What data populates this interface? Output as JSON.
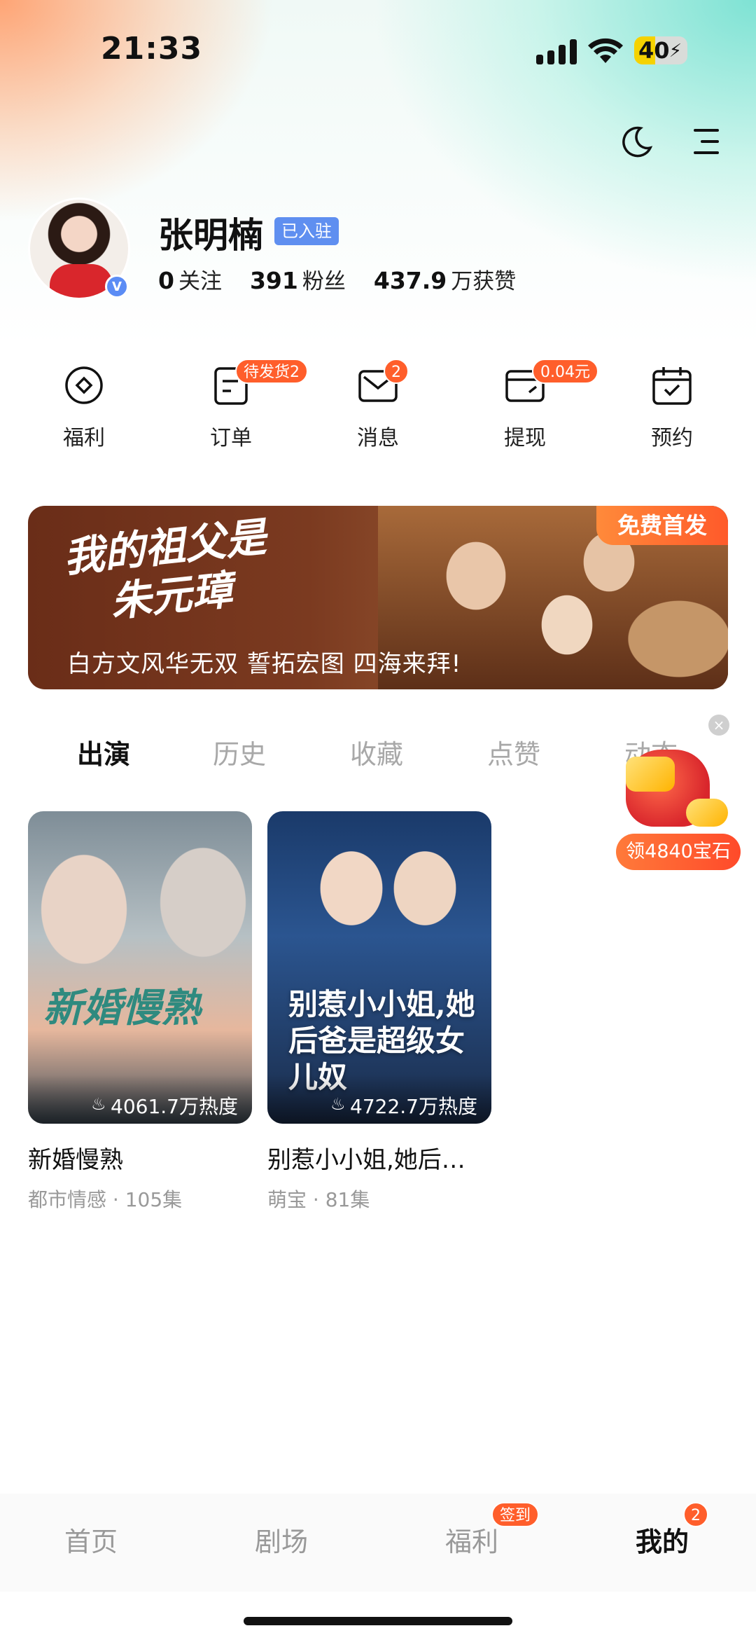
{
  "status": {
    "time": "21:33",
    "battery": "40"
  },
  "profile": {
    "name": "张明楠",
    "tag": "已入驻",
    "verify": "V",
    "stats": [
      {
        "num": "0",
        "label": "关注"
      },
      {
        "num": "391",
        "label": "粉丝"
      },
      {
        "num": "437.9",
        "label": "万获赞"
      }
    ]
  },
  "quick": [
    {
      "label": "福利",
      "badge": ""
    },
    {
      "label": "订单",
      "badge": "待发货2"
    },
    {
      "label": "消息",
      "badge": "2"
    },
    {
      "label": "提现",
      "badge": "0.04元"
    },
    {
      "label": "预约",
      "badge": ""
    }
  ],
  "banner": {
    "calligraphy_line1": "我的祖父是",
    "calligraphy_line2": "朱元璋",
    "slogan": "白方文风华无双 誓拓宏图 四海来拜!",
    "free": "免费首发"
  },
  "tabs": [
    "出演",
    "历史",
    "收藏",
    "点赞",
    "动态"
  ],
  "float": {
    "label": "领4840宝石",
    "close": "×"
  },
  "cards": [
    {
      "poster_title": "新婚慢熟",
      "heat": "4061.7万热度",
      "name": "新婚慢熟",
      "meta": "都市情感 · 105集"
    },
    {
      "poster_title": "别惹小小姐,她后爸是超级女儿奴",
      "heat": "4722.7万热度",
      "name": "别惹小小姐,她后…",
      "meta": "萌宝 · 81集"
    }
  ],
  "nav": {
    "items": [
      "首页",
      "剧场",
      "福利",
      "我的"
    ],
    "fuli_badge": "签到",
    "mine_badge": "2"
  },
  "colors": {
    "accent": "#ff5e2b",
    "tag_blue": "#5f8ff0"
  },
  "icons": {
    "top": [
      "moon-icon",
      "menu-icon"
    ],
    "quick": [
      "target-icon",
      "order-icon",
      "message-icon",
      "wallet-icon",
      "calendar-icon"
    ]
  }
}
